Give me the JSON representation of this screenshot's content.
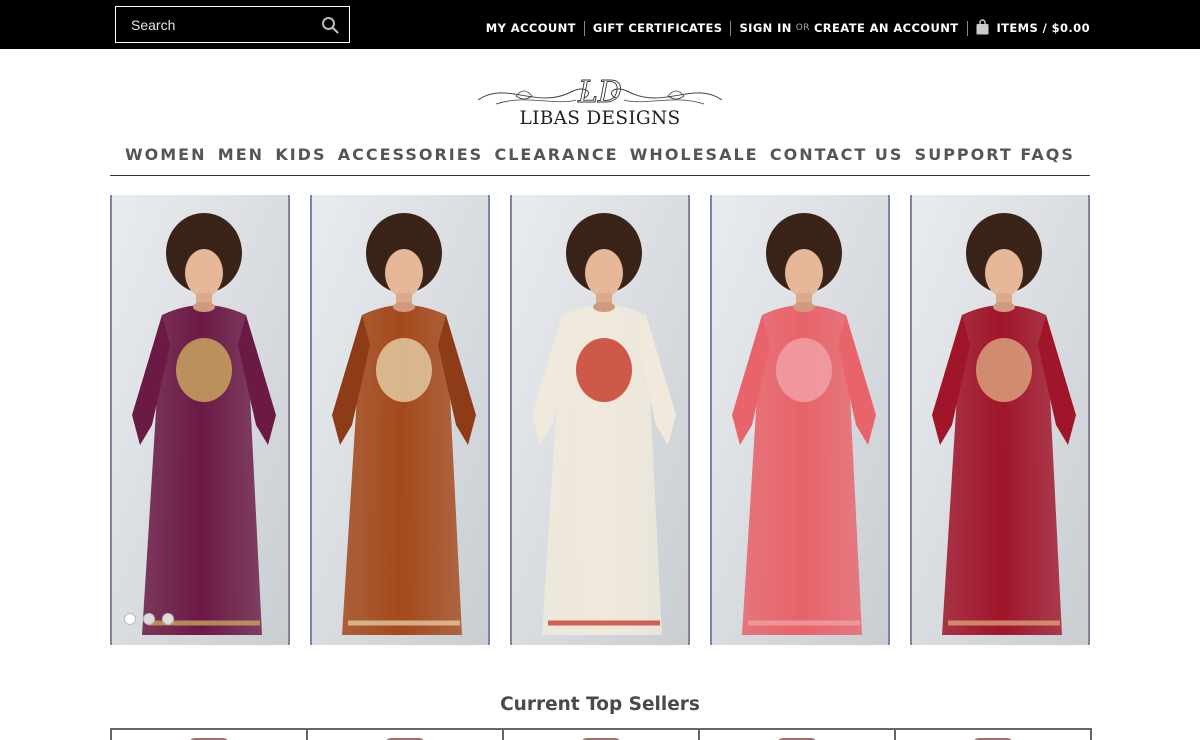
{
  "search": {
    "placeholder": "Search"
  },
  "top_links": {
    "my_account": "MY ACCOUNT",
    "gift_certificates": "GIFT CERTIFICATES",
    "sign_in": "SIGN IN",
    "or": "OR",
    "create_account": "CREATE AN ACCOUNT",
    "cart": "ITEMS / $0.00"
  },
  "logo": {
    "text": "LIBAS DESIGNS",
    "monogram": "LD"
  },
  "nav": {
    "items": [
      "WOMEN",
      "MEN",
      "KIDS",
      "ACCESSORIES",
      "CLEARANCE",
      "WHOLESALE",
      "CONTACT US",
      "SUPPORT FAQS"
    ]
  },
  "hero": {
    "panels": [
      {
        "dress": "#6b1a45",
        "accent": "#c9a35d",
        "sleeve": "#6b1a45"
      },
      {
        "dress": "#a4491c",
        "accent": "#e2c9a0",
        "sleeve": "#8e3c17"
      },
      {
        "dress": "#f0e9dc",
        "accent": "#c9402f",
        "sleeve": "#f0e9dc"
      },
      {
        "dress": "#e8636a",
        "accent": "#f0a0a4",
        "sleeve": "#e8636a"
      },
      {
        "dress": "#a0152a",
        "accent": "#d9a07a",
        "sleeve": "#a0152a"
      }
    ],
    "slide_count": 3,
    "active_slide": 1
  },
  "sellers": {
    "title": "Current Top Sellers",
    "count": 5
  },
  "colors": {
    "topbar": "#000000",
    "nav_text": "#555555",
    "panel_border": "#7c82a9"
  }
}
